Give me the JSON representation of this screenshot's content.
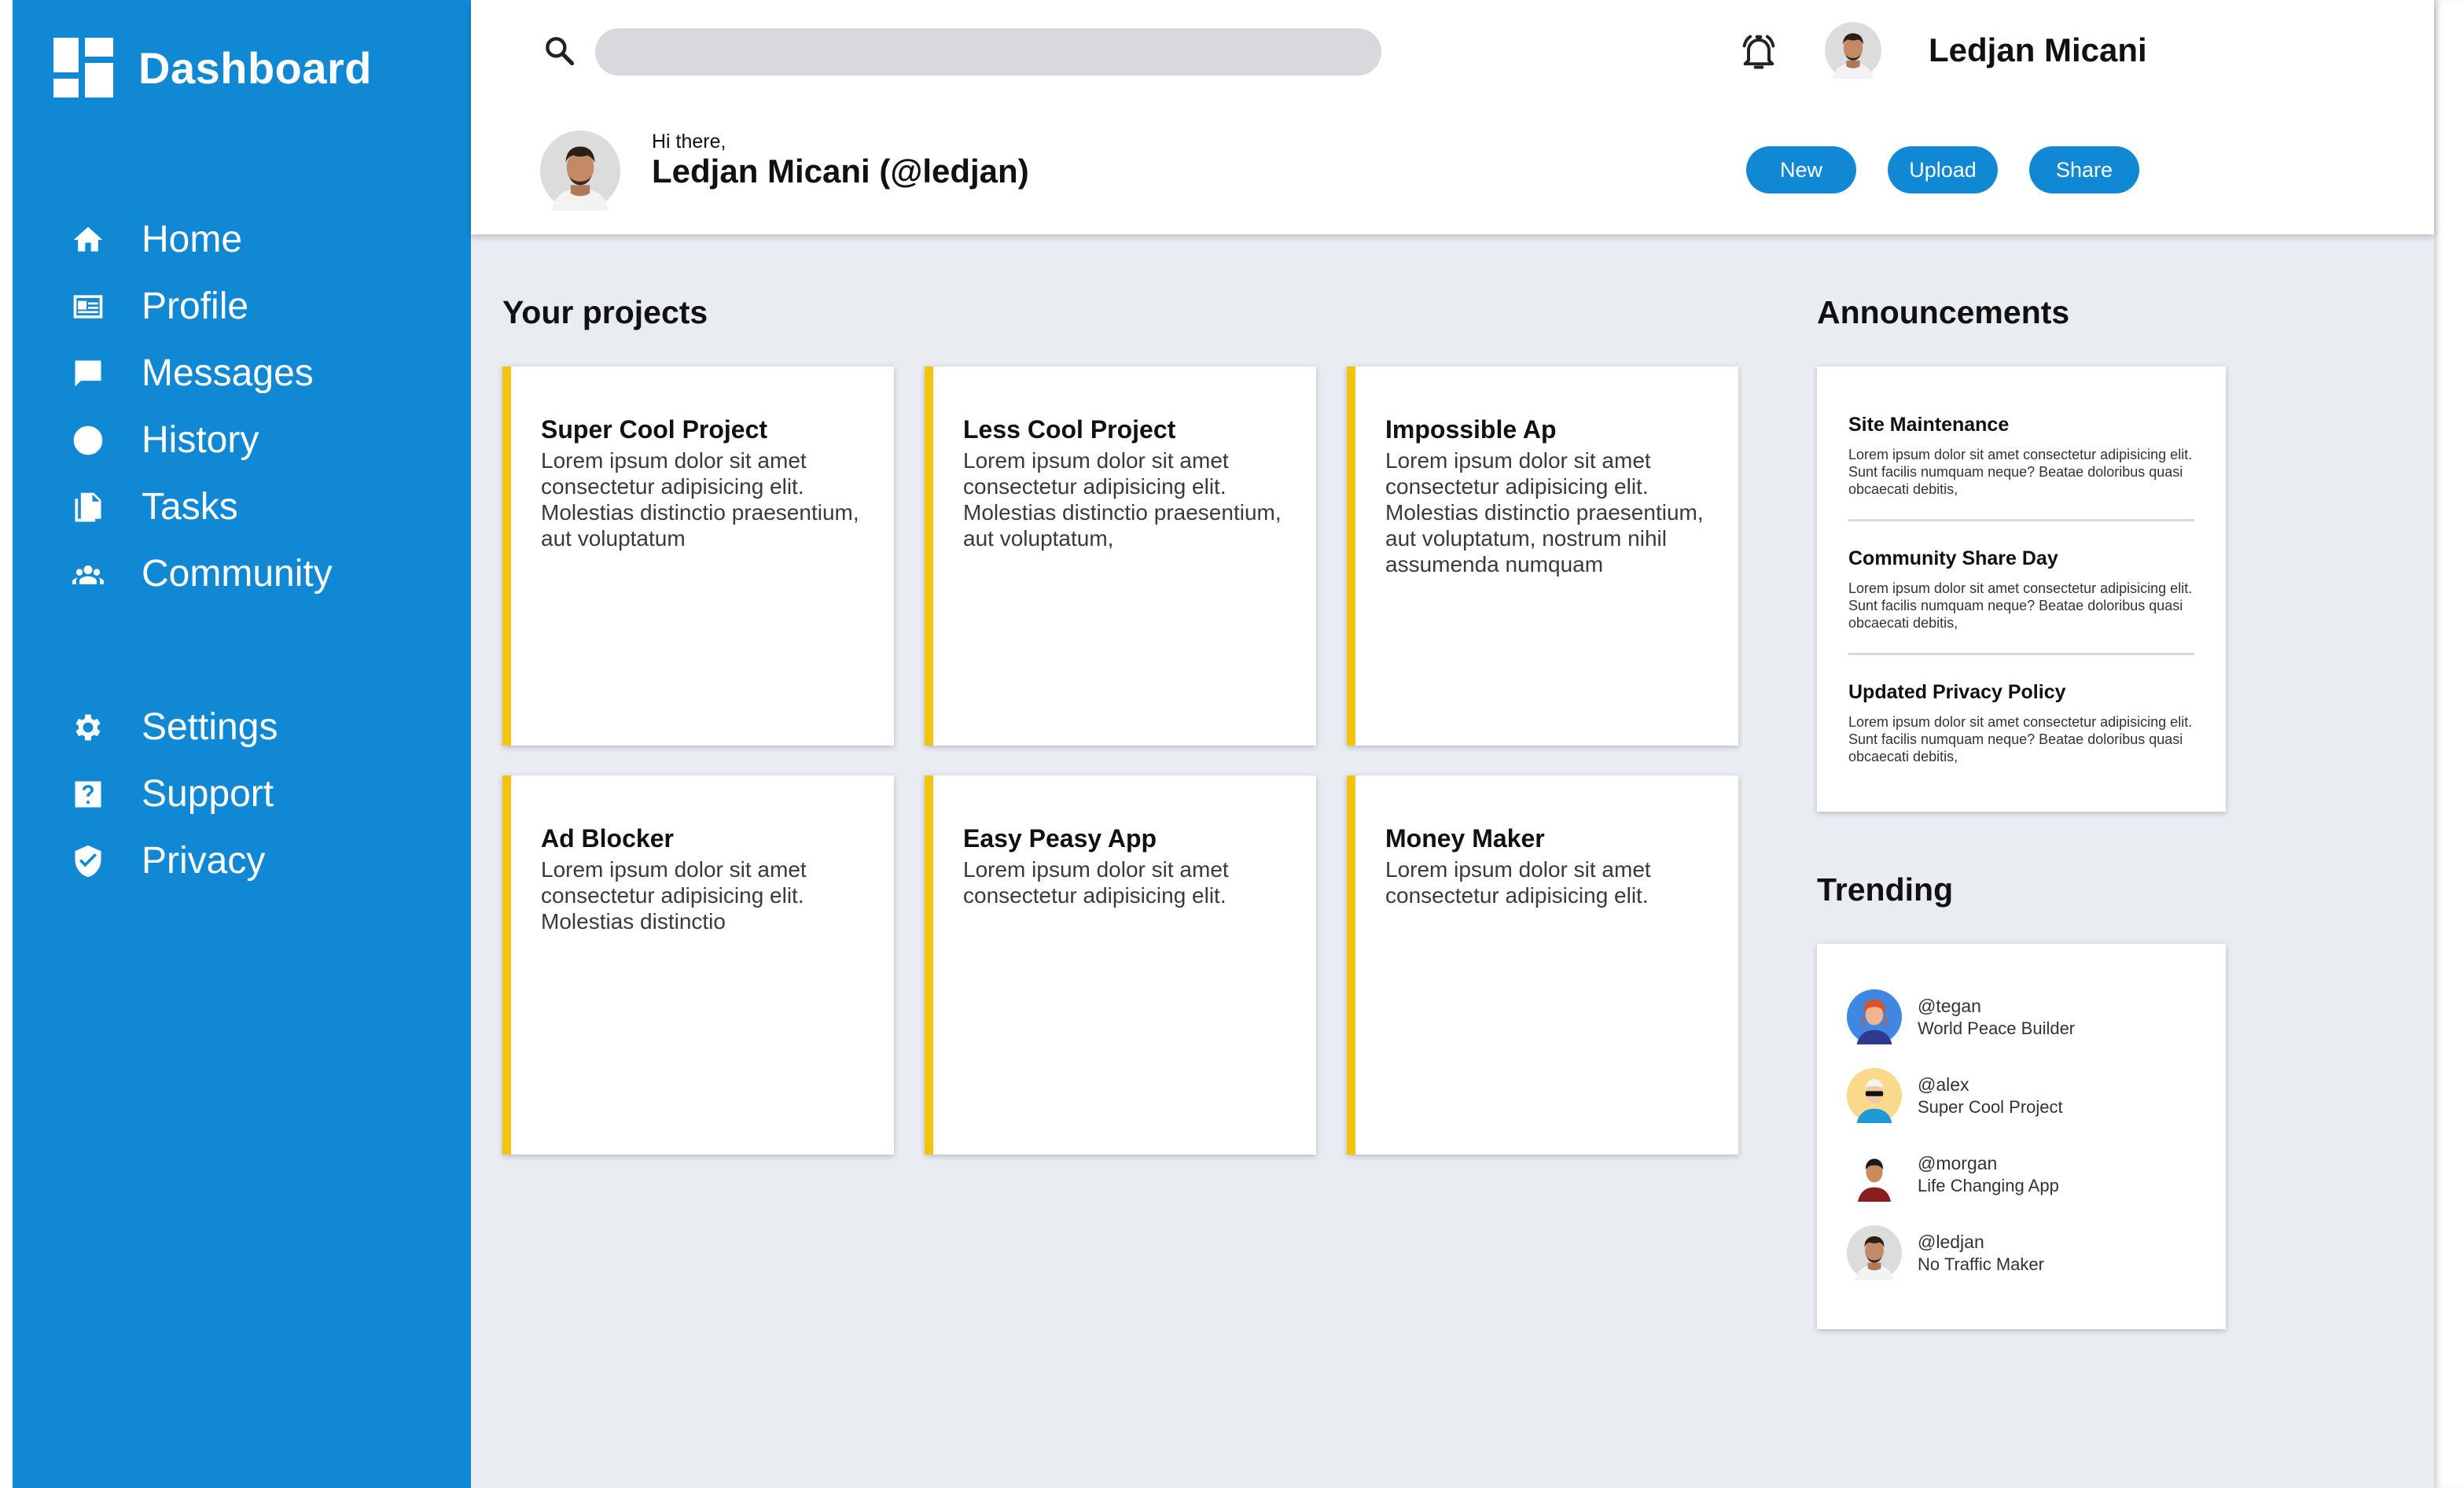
{
  "brand": {
    "title": "Dashboard"
  },
  "nav_primary": [
    {
      "label": "Home",
      "icon": "home-icon"
    },
    {
      "label": "Profile",
      "icon": "id-card-icon"
    },
    {
      "label": "Messages",
      "icon": "chat-icon"
    },
    {
      "label": "History",
      "icon": "clock-icon"
    },
    {
      "label": "Tasks",
      "icon": "documents-icon"
    },
    {
      "label": "Community",
      "icon": "people-icon"
    }
  ],
  "nav_secondary": [
    {
      "label": "Settings",
      "icon": "gear-icon"
    },
    {
      "label": "Support",
      "icon": "help-icon"
    },
    {
      "label": "Privacy",
      "icon": "shield-icon"
    }
  ],
  "header": {
    "search_placeholder": "",
    "user_name": "Ledjan Micani",
    "greeting_small": "Hi there,",
    "greeting_name": "Ledjan Micani (@ledjan)",
    "buttons": {
      "new": "New",
      "upload": "Upload",
      "share": "Share"
    }
  },
  "projects": {
    "title": "Your projects",
    "items": [
      {
        "title": "Super Cool Project",
        "desc": "Lorem ipsum dolor sit amet consectetur adipisicing elit. Molestias distinctio praesentium, aut voluptatum"
      },
      {
        "title": "Less Cool Project",
        "desc": "Lorem ipsum dolor sit amet consectetur adipisicing elit. Molestias distinctio praesentium, aut voluptatum,"
      },
      {
        "title": "Impossible Ap",
        "desc": "Lorem ipsum dolor sit amet consectetur adipisicing elit. Molestias distinctio praesentium, aut voluptatum, nostrum nihil assumenda numquam"
      },
      {
        "title": "Ad Blocker",
        "desc": "Lorem ipsum dolor sit amet consectetur adipisicing elit. Molestias distinctio"
      },
      {
        "title": "Easy Peasy App",
        "desc": "Lorem ipsum dolor sit amet consectetur adipisicing elit."
      },
      {
        "title": "Money Maker",
        "desc": "Lorem ipsum dolor sit amet consectetur adipisicing elit."
      }
    ]
  },
  "announcements": {
    "title": "Announcements",
    "items": [
      {
        "title": "Site Maintenance",
        "text": "Lorem ipsum dolor sit amet consectetur adipisicing elit. Sunt facilis numquam neque? Beatae doloribus quasi obcaecati debitis,"
      },
      {
        "title": "Community Share Day",
        "text": "Lorem ipsum dolor sit amet consectetur adipisicing elit. Sunt facilis numquam neque? Beatae doloribus quasi obcaecati debitis,"
      },
      {
        "title": "Updated Privacy Policy",
        "text": "Lorem ipsum dolor sit amet consectetur adipisicing elit. Sunt facilis numquam neque? Beatae doloribus quasi obcaecati debitis,"
      }
    ]
  },
  "trending": {
    "title": "Trending",
    "items": [
      {
        "handle": "@tegan",
        "project": "World Peace Builder"
      },
      {
        "handle": "@alex",
        "project": "Super Cool Project"
      },
      {
        "handle": "@morgan",
        "project": "Life Changing App"
      },
      {
        "handle": "@ledjan",
        "project": "No Traffic Maker"
      }
    ]
  },
  "colors": {
    "sidebar": "#1188d4",
    "accent": "#f2c40f",
    "background": "#e9edf2",
    "search": "#d7d9dd"
  }
}
